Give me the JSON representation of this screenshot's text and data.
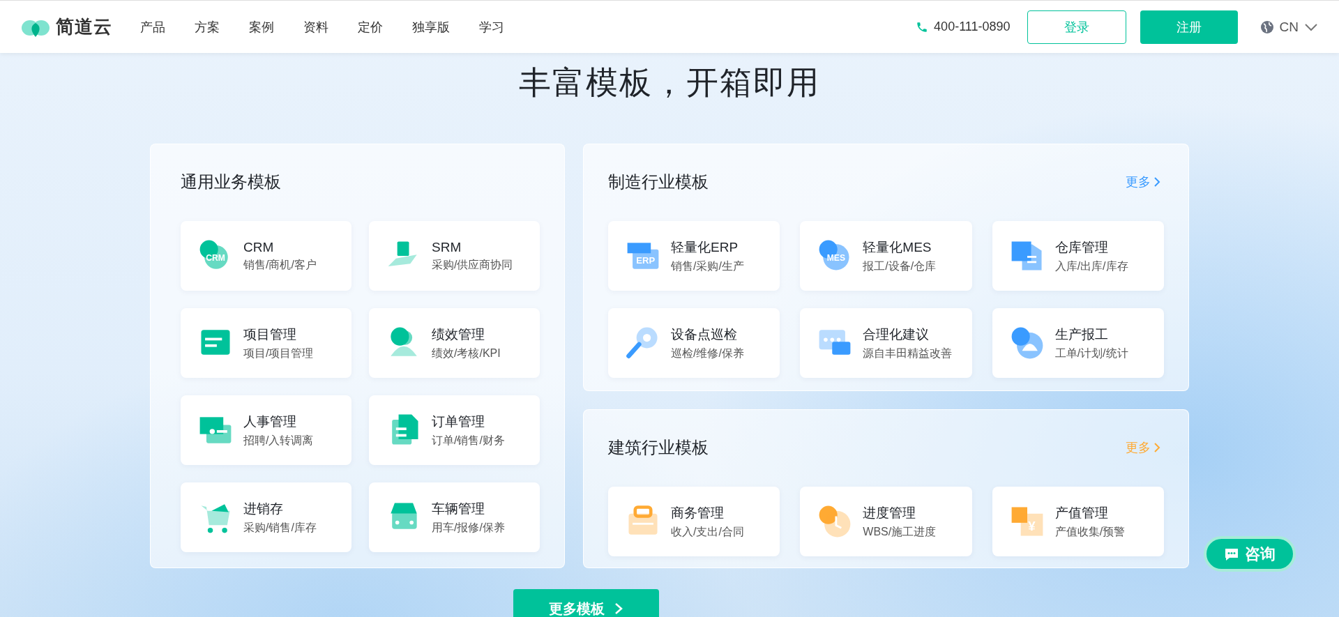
{
  "header": {
    "logo": "简道云",
    "nav": [
      "产品",
      "方案",
      "案例",
      "资料",
      "定价",
      "独享版",
      "学习"
    ],
    "phone": "400-111-0890",
    "login": "登录",
    "register": "注册",
    "language": "CN"
  },
  "title": "丰富模板，开箱即用",
  "sections": [
    {
      "title": "通用业务模板",
      "color": "#00c29a",
      "items": [
        {
          "name": "CRM",
          "desc": "销售/商机/客户",
          "badge": "CRM"
        },
        {
          "name": "SRM",
          "desc": "采购/供应商协同"
        },
        {
          "name": "项目管理",
          "desc": "项目/项目管理"
        },
        {
          "name": "绩效管理",
          "desc": "绩效/考核/KPI"
        },
        {
          "name": "人事管理",
          "desc": "招聘/入转调离"
        },
        {
          "name": "订单管理",
          "desc": "订单/销售/财务"
        },
        {
          "name": "进销存",
          "desc": "采购/销售/库存"
        },
        {
          "name": "车辆管理",
          "desc": "用车/报修/保养"
        }
      ]
    },
    {
      "title": "制造行业模板",
      "more": "更多",
      "color": "#3a9bff",
      "items": [
        {
          "name": "轻量化ERP",
          "desc": "销售/采购/生产",
          "badge": "ERP"
        },
        {
          "name": "轻量化MES",
          "desc": "报工/设备/仓库",
          "badge": "MES"
        },
        {
          "name": "仓库管理",
          "desc": "入库/出库/库存"
        },
        {
          "name": "设备点巡检",
          "desc": "巡检/维修/保养"
        },
        {
          "name": "合理化建议",
          "desc": "源自丰田精益改善"
        },
        {
          "name": "生产报工",
          "desc": "工单/计划/统计"
        }
      ]
    },
    {
      "title": "建筑行业模板",
      "more": "更多",
      "color": "#ffaa33",
      "items": [
        {
          "name": "商务管理",
          "desc": "收入/支出/合同"
        },
        {
          "name": "进度管理",
          "desc": "WBS/施工进度"
        },
        {
          "name": "产值管理",
          "desc": "产值收集/预警",
          "badge": "¥"
        }
      ]
    }
  ],
  "more_templates": "更多模板",
  "consult": "咨询"
}
